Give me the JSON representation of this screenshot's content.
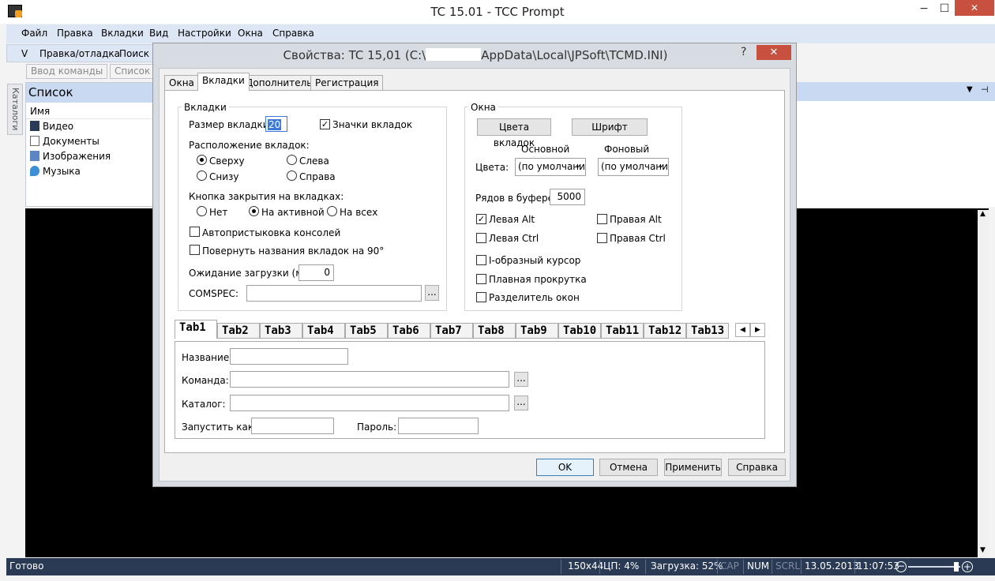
{
  "window": {
    "title": "TC 15.01 - TCC Prompt",
    "min": "−",
    "max": "☐",
    "close": "✕"
  },
  "menu": [
    "Файл",
    "Правка",
    "Вкладки",
    "Вид",
    "Настройки",
    "Окна",
    "Справка"
  ],
  "toolbar1": {
    "grip": "V",
    "edit_debug": "Правка/отладка",
    "search": "Поиск"
  },
  "toolbar2": {
    "command_input": "Ввод команды",
    "list": "Список"
  },
  "side_tab": "Каталоги",
  "list_panel": {
    "title": "Список",
    "column": "Имя",
    "items": [
      {
        "label": "Видео",
        "icon": "video-icon"
      },
      {
        "label": "Документы",
        "icon": "document-icon"
      },
      {
        "label": "Изображения",
        "icon": "image-icon"
      },
      {
        "label": "Музыка",
        "icon": "music-icon"
      }
    ]
  },
  "dialog": {
    "title_prefix": "Свойства: TC 15,01  (C:\\",
    "title_suffix": "AppData\\Local\\JPSoft\\TCMD.INI)",
    "help": "?",
    "close": "✕",
    "tabs": [
      "Окна",
      "Вкладки",
      "Дополнительно",
      "Регистрация"
    ],
    "tabs_group": {
      "label": "Вкладки",
      "tab_size_label": "Размер вкладки:",
      "tab_size_value": "20",
      "tab_icons_label": "Значки вкладок",
      "position_label": "Расположение вкладок:",
      "pos_top": "Сверху",
      "pos_left": "Слева",
      "pos_bottom": "Снизу",
      "pos_right": "Справа",
      "close_btn_label": "Кнопка закрытия на вкладках:",
      "close_none": "Нет",
      "close_active": "На активной",
      "close_all": "На всех",
      "auto_dock": "Автопристыковка консолей",
      "rotate_names": "Повернуть названия вкладок на 90°",
      "load_wait_label": "Ожидание загрузки (мс):",
      "load_wait_value": "0",
      "comspec_label": "COMSPEC:",
      "browse": "..."
    },
    "windows_group": {
      "label": "Окна",
      "tab_colors": "Цвета вкладок",
      "font": "Шрифт",
      "fg_label": "Основной",
      "bg_label": "Фоновый",
      "colors_label": "Цвета:",
      "fg_value": "(по умолчани",
      "bg_value": "(по умолчани",
      "buffer_rows_label": "Рядов в буфере:",
      "buffer_rows_value": "5000",
      "left_alt": "Левая Alt",
      "right_alt": "Правая Alt",
      "left_ctrl": "Левая Ctrl",
      "right_ctrl": "Правая Ctrl",
      "ibeam": "I-образный курсор",
      "smooth_scroll": "Плавная прокрутка",
      "splitter": "Разделитель окон"
    },
    "tab_defs": {
      "tabs": [
        "Tab1",
        "Tab2",
        "Tab3",
        "Tab4",
        "Tab5",
        "Tab6",
        "Tab7",
        "Tab8",
        "Tab9",
        "Tab10",
        "Tab11",
        "Tab12",
        "Tab13"
      ],
      "name_label": "Название:",
      "command_label": "Команда:",
      "folder_label": "Каталог:",
      "run_as_label": "Запустить как:",
      "password_label": "Пароль:",
      "browse": "..."
    },
    "buttons": {
      "ok": "OK",
      "cancel": "Отмена",
      "apply": "Применить",
      "help": "Справка"
    }
  },
  "status": {
    "ready": "Готово",
    "size": "150x44",
    "cpu": "ЦП:  4%",
    "load": "Загрузка: 52%",
    "cap": "CAP",
    "num": "NUM",
    "scrl": "SCRL",
    "date": "13.05.2013",
    "time": "11:07:53"
  }
}
